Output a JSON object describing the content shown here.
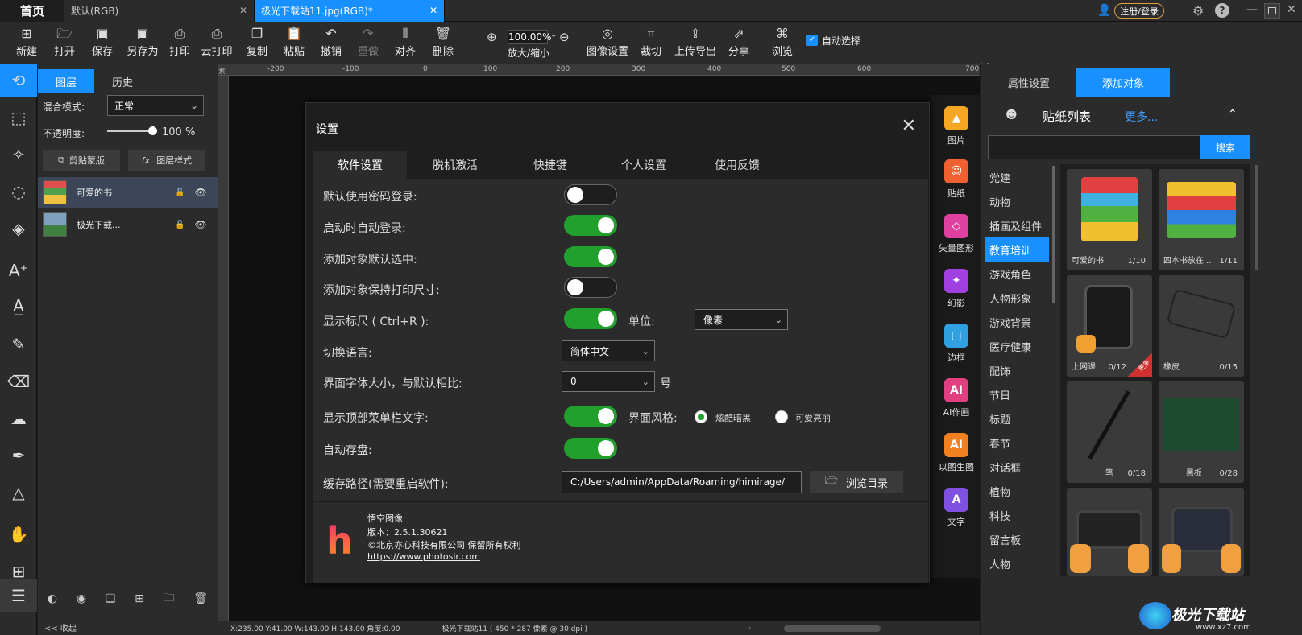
{
  "titlebar": {
    "home": "首页",
    "tabs": [
      {
        "label": "默认(RGB)",
        "active": false
      },
      {
        "label": "极光下载站11.jpg(RGB)*",
        "active": true
      }
    ],
    "login": "注册/登录"
  },
  "toolbar": {
    "items": [
      "新建",
      "打开",
      "保存",
      "另存为",
      "打印",
      "云打印",
      "复制",
      "粘贴",
      "撤销",
      "重做",
      "对齐",
      "删除"
    ],
    "zoom_value": "100.00%",
    "zoom_label": "放大/缩小",
    "items2": [
      "图像设置",
      "裁切",
      "上传导出",
      "分享",
      "浏览"
    ],
    "auto_select": "自动选择"
  },
  "layers_panel": {
    "tabs": [
      "图层",
      "历史"
    ],
    "blend_label": "混合模式:",
    "blend_value": "正常",
    "opacity_label": "不透明度:",
    "opacity_value": "100",
    "opacity_unit": "%",
    "opacity_fraction": 1.0,
    "clip_btn": "剪贴蒙版",
    "style_btn": "图层样式",
    "layers": [
      {
        "name": "可爱的书",
        "selected": true
      },
      {
        "name": "极光下载...",
        "selected": false
      }
    ],
    "collapse": "<< 收起"
  },
  "ruler": {
    "label": "像素",
    "ticks": [
      "-200",
      "-100",
      "0",
      "100",
      "200",
      "300",
      "400",
      "500",
      "600",
      "700"
    ]
  },
  "status": {
    "coords": "X:235.00 Y:41.00 W:143.00 H:143.00 角度:0.00",
    "doc": "极光下载站11 ( 450 * 287 像素 @ 30 dpi )"
  },
  "category_strip": [
    "图片",
    "贴纸",
    "矢量图形",
    "幻影",
    "边框",
    "AI作画",
    "以图生图",
    "文字"
  ],
  "right_panel": {
    "tabs": [
      "属性设置",
      "添加对象"
    ],
    "list_title": "贴纸列表",
    "more": "更多...",
    "search_btn": "搜索",
    "categories": [
      "党建",
      "动物",
      "插画及组件",
      "教育培训",
      "游戏角色",
      "人物形象",
      "游戏背景",
      "医疗健康",
      "配饰",
      "节日",
      "标题",
      "春节",
      "对话框",
      "植物",
      "科技",
      "留言板",
      "人物"
    ],
    "active_category": "教育培训",
    "stickers": [
      {
        "name": "可爱的书",
        "count": "1/10"
      },
      {
        "name": "四本书放在...",
        "count": "1/11"
      },
      {
        "name": "上网课",
        "count": "0/12",
        "badge": "更多"
      },
      {
        "name": "橡皮",
        "count": "0/15"
      },
      {
        "name": "笔",
        "count": "0/18"
      },
      {
        "name": "黑板",
        "count": "0/28"
      },
      {
        "name": "",
        "count": ""
      },
      {
        "name": "",
        "count": ""
      }
    ]
  },
  "dialog": {
    "title": "设置",
    "tabs": [
      "软件设置",
      "脱机激活",
      "快捷键",
      "个人设置",
      "使用反馈"
    ],
    "rows": {
      "r1": {
        "label": "默认使用密码登录:",
        "on": false
      },
      "r2": {
        "label": "启动时自动登录:",
        "on": true
      },
      "r3": {
        "label": "添加对象默认选中:",
        "on": true
      },
      "r4": {
        "label": "添加对象保持打印尺寸:",
        "on": false
      },
      "r5": {
        "label": "显示标尺 ( Ctrl+R ):",
        "on": true
      },
      "r6": {
        "label": "切换语言:"
      },
      "r7": {
        "label": "界面字体大小，与默认相比:"
      },
      "r8": {
        "label": "显示顶部菜单栏文字:",
        "on": true
      },
      "r9": {
        "label": "自动存盘:",
        "on": true
      },
      "r10": {
        "label": "缓存路径(需要重启软件):"
      }
    },
    "unit_label": "单位:",
    "unit_value": "像素",
    "language_value": "简体中文",
    "font_size_value": "0",
    "font_size_suffix": "号",
    "style_label": "界面风格:",
    "style_options": [
      "炫酷暗黑",
      "可爱亮丽"
    ],
    "style_selected": "炫酷暗黑",
    "cache_path": "C:/Users/admin/AppData/Roaming/himirage/",
    "browse_btn": "浏览目录",
    "footer": {
      "app_name": "悟空图像",
      "version": "版本：2.5.1.30621",
      "copyright": "©北京亦心科技有限公司 保留所有权利",
      "url": "https://www.photosir.com"
    }
  },
  "watermark": {
    "text": "极光下载站",
    "url": "www.xz7.com"
  },
  "colors": {
    "accent": "#1890ff",
    "toggle_on": "#22a02e",
    "bg": "#1e1e1e",
    "panel": "#2b2b2b"
  }
}
